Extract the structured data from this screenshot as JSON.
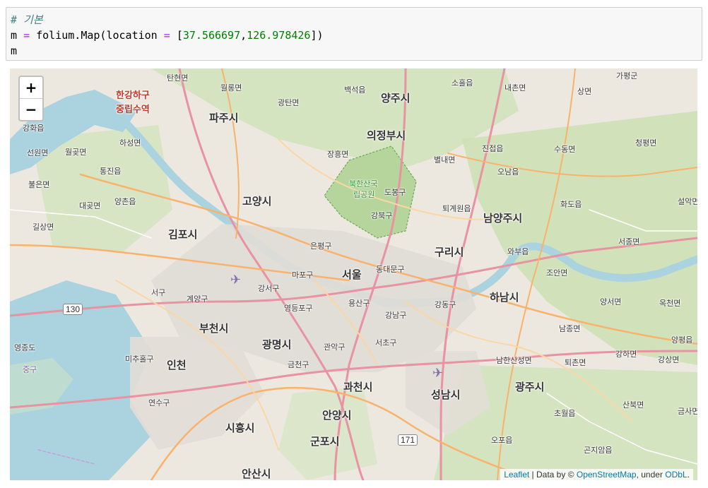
{
  "cell": {
    "line1": "# 기본",
    "line2_var": "m",
    "line2_eq": "=",
    "line2_call": "folium.Map(location",
    "line2_eq2": "=",
    "line2_open": "[",
    "line2_lat": "37.566697",
    "line2_comma": ",",
    "line2_lon": "126.978426",
    "line2_close": "])",
    "line3": "m"
  },
  "map": {
    "zoom_in": "+",
    "zoom_out": "−",
    "attribution": {
      "leaflet": "Leaflet",
      "sep": " | Data by © ",
      "osm": "OpenStreetMap",
      "under": ", under ",
      "odbl": "ODbL",
      "end": "."
    },
    "shields": [
      "130",
      "171"
    ],
    "labels": {
      "tanhyeon": "탄현면",
      "wollong": "월롱면",
      "gwangtan": "광탄면",
      "baekseok": "백석읍",
      "yangju": "양주시",
      "soheul": "소흘읍",
      "naechon": "내촌면",
      "sangmyeon": "상면",
      "gapyeong": "가평군",
      "hangang_estuary": "한강하구",
      "neutral_zone": "중립수역",
      "paju": "파주시",
      "uijeongbu": "의정부시",
      "ganghwa": "강화읍",
      "haseong": "하성면",
      "jinjeop": "진접읍",
      "sudong": "수동면",
      "cheongpyeong": "청평면",
      "seonwon": "선원면",
      "wolgot": "월곶면",
      "janghung": "장흥면",
      "byeolnae": "별내면",
      "onam": "오남읍",
      "tongjin": "통진읍",
      "bukhansan": "북한산국",
      "bukhansan2": "립공원",
      "dobong": "도봉구",
      "buleun": "불은면",
      "goyang": "고양시",
      "toegyewon": "퇴계원읍",
      "hwado": "화도읍",
      "seorak": "설악면",
      "daegot": "대곶면",
      "yangchon": "양촌읍",
      "gangbuk": "강북구",
      "namyangju": "남양주시",
      "gilsang": "길상면",
      "gimpo": "김포시",
      "eunpyeong": "은평구",
      "guri": "구리시",
      "seojong": "서종면",
      "wabu": "와부읍",
      "mapo": "마포구",
      "seoul": "서울",
      "dongdaemun": "동대문구",
      "joan": "조안면",
      "seogu": "서구",
      "gangseo": "강서구",
      "gyeyang": "계양구",
      "yongsan": "용산구",
      "gangnam": "강남구",
      "gangdong": "강동구",
      "hanam": "하남시",
      "yangseo": "양서면",
      "okcheon": "옥천면",
      "yeongdeungpo": "영등포구",
      "bucheon": "부천시",
      "namjong": "남종면",
      "yeongjong": "영종도",
      "gwangmyeong": "광명시",
      "gwanak": "관악구",
      "seocho": "서초구",
      "yangpyeong": "양평읍",
      "gangha": "강하면",
      "gangsang": "강상면",
      "michuhol": "미추홀구",
      "incheon": "인천",
      "geumcheon": "금천구",
      "namhansanseong": "남한산성면",
      "toechon": "퇴촌면",
      "junggu": "중구",
      "gwacheon": "과천시",
      "gwangju": "광주시",
      "yeonsu": "연수구",
      "seongnam": "성남시",
      "sanbuk": "산북면",
      "geumsa": "금사면",
      "anyang": "안양시",
      "chowol": "초월읍",
      "siheung": "시흥시",
      "gunpo": "군포시",
      "opo": "오포읍",
      "gonjiam": "곤지암읍",
      "ansan": "안산시"
    }
  }
}
